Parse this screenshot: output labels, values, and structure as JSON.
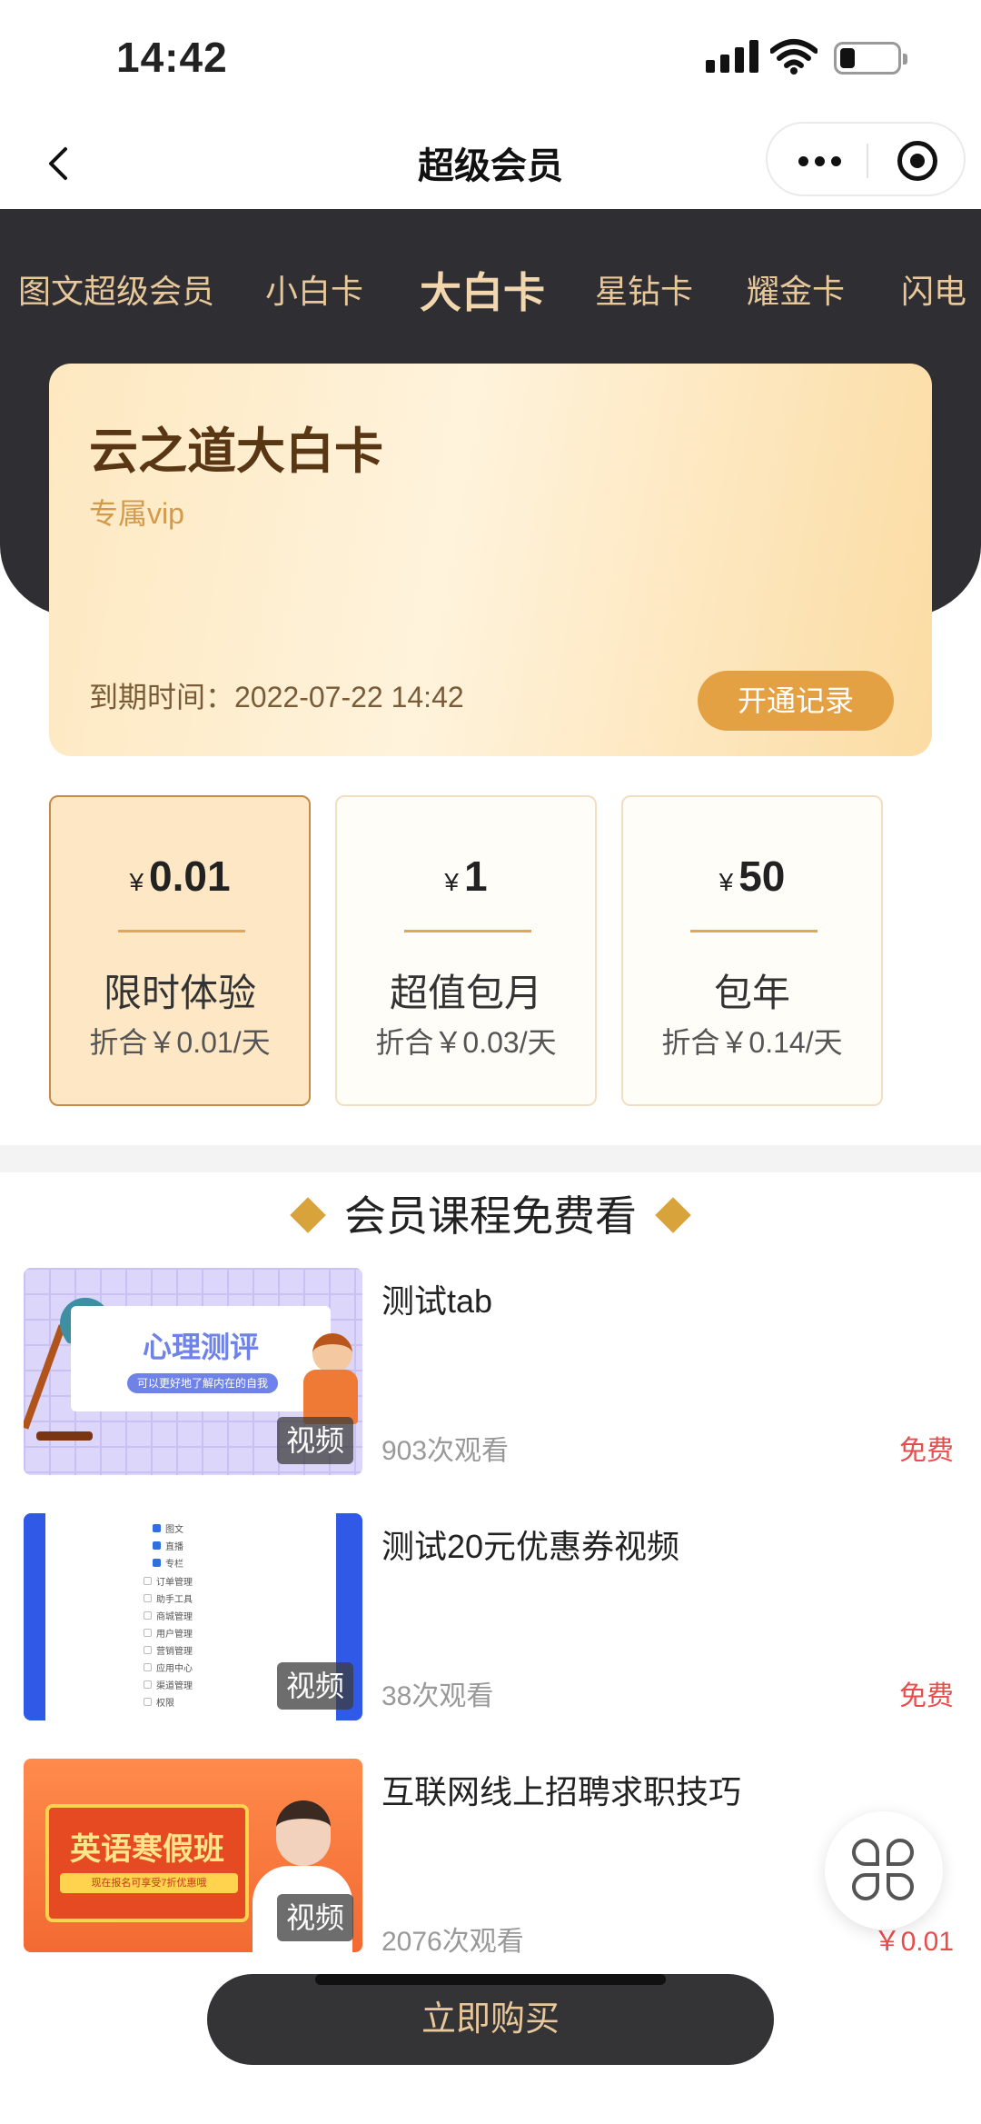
{
  "status_bar": {
    "time": "14:42"
  },
  "nav": {
    "title": "超级会员"
  },
  "tabs": [
    {
      "label": "图文超级会员",
      "active": false
    },
    {
      "label": "小白卡",
      "active": false
    },
    {
      "label": "大白卡",
      "active": true
    },
    {
      "label": "星钻卡",
      "active": false
    },
    {
      "label": "耀金卡",
      "active": false
    },
    {
      "label": "闪电",
      "active": false
    }
  ],
  "card": {
    "title": "云之道大白卡",
    "subtitle": "专属vip",
    "expire": "到期时间：2022-07-22 14:42",
    "record_button": "开通记录"
  },
  "plans": [
    {
      "currency": "¥",
      "price": "0.01",
      "name": "限时体验",
      "daily": "折合￥0.01/天",
      "selected": true
    },
    {
      "currency": "¥",
      "price": "1",
      "name": "超值包月",
      "daily": "折合￥0.03/天",
      "selected": false
    },
    {
      "currency": "¥",
      "price": "50",
      "name": "包年",
      "daily": "折合￥0.14/天",
      "selected": false
    }
  ],
  "section": {
    "title": "会员课程免费看"
  },
  "courses": [
    {
      "title": "测试tab",
      "views": "903次观看",
      "price": "免费",
      "badge": "视频",
      "thumb_title": "心理测评",
      "thumb_subtitle": "可以更好地了解内在的自我"
    },
    {
      "title": "测试20元优惠券视频",
      "views": "38次观看",
      "price": "免费",
      "badge": "视频",
      "thumb_lines": [
        "图文",
        "直播",
        "专栏",
        "订单管理",
        "助手工具",
        "商城管理",
        "用户管理",
        "营销管理",
        "应用中心",
        "渠道管理",
        "权限"
      ]
    },
    {
      "title": "互联网线上招聘求职技巧",
      "views": "2076次观看",
      "price": "￥0.01",
      "badge": "视频",
      "thumb_title": "英语寒假班",
      "thumb_subtitle": "现在报名可享受7折优惠哦"
    }
  ],
  "bottom": {
    "buy_button": "立即购买"
  },
  "colors": {
    "dark": "#2f2f33",
    "gold": "#e3a143",
    "tab_text": "#e8c89a",
    "price_red": "#e84d4d"
  }
}
